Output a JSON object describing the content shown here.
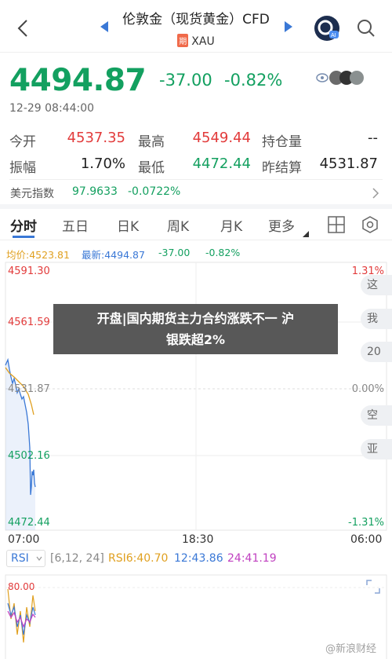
{
  "header": {
    "title": "伦敦金（现货黄金）CFD",
    "badge": "期",
    "subtitle": "XAU"
  },
  "quote": {
    "last": "4494.87",
    "change": "-37.00",
    "change_pct": "-0.82%",
    "time": "12-29 08:44:00"
  },
  "stats": [
    {
      "label": "今开",
      "value": "4537.35",
      "color": "red"
    },
    {
      "label": "最高",
      "value": "4549.44",
      "color": "red"
    },
    {
      "label": "持仓量",
      "value": "--",
      "color": "dark"
    },
    {
      "label": "振幅",
      "value": "1.70%",
      "color": "dark"
    },
    {
      "label": "最低",
      "value": "4472.44",
      "color": "green"
    },
    {
      "label": "昨结算",
      "value": "4531.87",
      "color": "dark"
    }
  ],
  "usd_index": {
    "label": "美元指数",
    "value": "97.9633",
    "change": "-0.0722%"
  },
  "tabs": [
    "分时",
    "五日",
    "日K",
    "周K",
    "月K",
    "更多"
  ],
  "legend": {
    "avg": "均价:4523.81",
    "latest": "最新:4494.87",
    "chg": "-37.00",
    "pct": "-0.82%"
  },
  "y_labels": {
    "top": "4591.30",
    "upper": "4561.59",
    "mid": "4531.87",
    "lower": "4502.16",
    "bottom": "4472.44",
    "pct_top": "1.31%",
    "pct_mid": "0.00%",
    "pct_bottom": "-1.31%"
  },
  "time_labels": {
    "start": "07:00",
    "mid": "18:30",
    "end": "06:00"
  },
  "side_chips": [
    "这",
    "我",
    "20",
    "空",
    "亚"
  ],
  "banner": {
    "line1": "开盘|国内期货主力合约涨跌不一 沪",
    "line2": "银跌超2%"
  },
  "rsi": {
    "selector": "RSI",
    "params": "[6,12, 24]",
    "rsi6": "RSI6:40.70",
    "rsi12": "12:43.86",
    "rsi24": "24:41.19",
    "axis_top": "80.00"
  },
  "watermark": "@新浪财经",
  "colors": {
    "up": "#e23b3b",
    "down": "#14a060",
    "accent": "#3a78d6",
    "avg": "#e0a020"
  }
}
